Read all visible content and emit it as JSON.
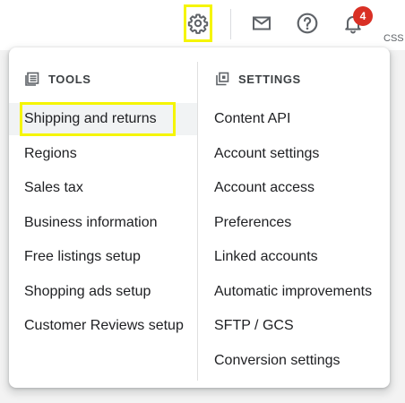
{
  "topbar": {
    "icons": [
      "gear-icon",
      "mail-icon",
      "help-icon",
      "bell-icon"
    ],
    "notification_count": "4",
    "account_text": "CSS"
  },
  "menu": {
    "tools": {
      "title": "TOOLS",
      "icon": "tools-grid-icon",
      "items": [
        {
          "label": "Shipping and returns"
        },
        {
          "label": "Regions"
        },
        {
          "label": "Sales tax"
        },
        {
          "label": "Business information"
        },
        {
          "label": "Free listings setup"
        },
        {
          "label": "Shopping ads setup"
        },
        {
          "label": "Customer Reviews setup"
        }
      ]
    },
    "settings": {
      "title": "SETTINGS",
      "icon": "settings-copy-icon",
      "items": [
        {
          "label": "Content API"
        },
        {
          "label": "Account settings"
        },
        {
          "label": "Account access"
        },
        {
          "label": "Preferences"
        },
        {
          "label": "Linked accounts"
        },
        {
          "label": "Automatic improvements"
        },
        {
          "label": "SFTP / GCS"
        },
        {
          "label": "Conversion settings"
        }
      ]
    }
  },
  "colors": {
    "highlight": "#f5f500",
    "badge": "#d93025",
    "icon": "#5f6368"
  }
}
